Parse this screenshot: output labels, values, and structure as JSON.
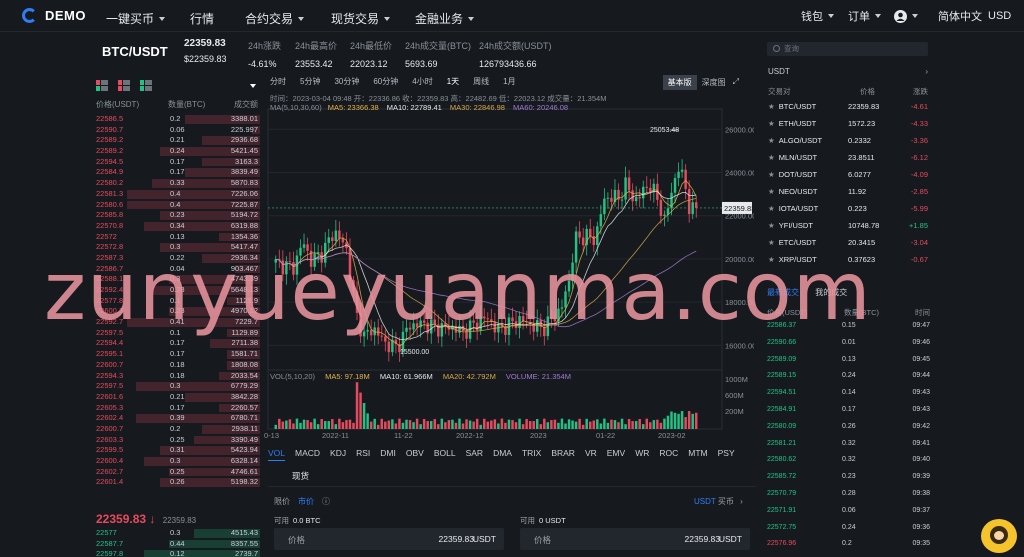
{
  "nav": {
    "brand": "DEMO",
    "items": [
      "一键买币",
      "行情",
      "合约交易",
      "现货交易",
      "金融业务"
    ],
    "wallet": "钱包",
    "orders": "订单",
    "language": "简体中文",
    "currency": "USD"
  },
  "ticker": {
    "pair": "BTC/USDT",
    "last": "22359.83",
    "last_fiat": "$22359.83",
    "change_label": "24h涨跌",
    "change": "-4.61%",
    "high_label": "24h最高价",
    "high": "23553.42",
    "low_label": "24h最低价",
    "low": "22023.12",
    "vol_label": "24h成交量(BTC)",
    "vol": "5693.69",
    "amount_label": "24h成交额(USDT)",
    "amount": "126793436.66"
  },
  "book": {
    "headers": [
      "价格(USDT)",
      "数量(BTC)",
      "成交额"
    ],
    "asks": [
      [
        "22586.5",
        "0.2",
        "3388.01"
      ],
      [
        "22590.7",
        "0.06",
        "225.997"
      ],
      [
        "22589.2",
        "0.21",
        "2936.68"
      ],
      [
        "22589.2",
        "0.24",
        "5421.45"
      ],
      [
        "22594.5",
        "0.17",
        "3163.3"
      ],
      [
        "22584.9",
        "0.17",
        "3839.49"
      ],
      [
        "22580.2",
        "0.33",
        "5870.83"
      ],
      [
        "22581.3",
        "0.4",
        "7226.06"
      ],
      [
        "22580.6",
        "0.4",
        "7225.87"
      ],
      [
        "22585.8",
        "0.23",
        "5194.72"
      ],
      [
        "22570.8",
        "0.34",
        "6319.88"
      ],
      [
        "22572",
        "0.13",
        "1354.36"
      ],
      [
        "22572.8",
        "0.3",
        "5417.47"
      ],
      [
        "22587.3",
        "0.22",
        "2936.34"
      ],
      [
        "22586.7",
        "0.04",
        "903.467"
      ],
      [
        "22588.1",
        "0.3",
        "4743.39"
      ],
      [
        "22592.4",
        "0.28",
        "5648.13"
      ],
      [
        "22577.8",
        "0.1",
        "1129.9"
      ],
      [
        "22600.3",
        "0.23",
        "4970.12"
      ],
      [
        "22592.7",
        "0.41",
        "7229.7"
      ],
      [
        "22597.5",
        "0.1",
        "1129.89"
      ],
      [
        "22594.4",
        "0.17",
        "2711.38"
      ],
      [
        "22595.1",
        "0.17",
        "1581.71"
      ],
      [
        "22600.7",
        "0.18",
        "1808.08"
      ],
      [
        "22594.3",
        "0.18",
        "2033.54"
      ],
      [
        "22597.5",
        "0.3",
        "6779.29"
      ],
      [
        "22601.6",
        "0.21",
        "3842.28"
      ],
      [
        "22605.3",
        "0.17",
        "2260.57"
      ],
      [
        "22602.4",
        "0.39",
        "6780.71"
      ],
      [
        "22600.7",
        "0.2",
        "2938.11"
      ],
      [
        "22603.3",
        "0.25",
        "3390.49"
      ],
      [
        "22599.5",
        "0.31",
        "5423.94"
      ],
      [
        "22600.4",
        "0.3",
        "6328.14"
      ],
      [
        "22602.7",
        "0.25",
        "4746.61"
      ],
      [
        "22601.4",
        "0.26",
        "5198.32"
      ]
    ],
    "ask_depth": [
      0.45,
      0.05,
      0.35,
      0.6,
      0.35,
      0.45,
      0.65,
      0.8,
      0.8,
      0.6,
      0.7,
      0.25,
      0.6,
      0.35,
      0.15,
      0.55,
      0.65,
      0.2,
      0.55,
      0.8,
      0.2,
      0.3,
      0.2,
      0.2,
      0.25,
      0.75,
      0.45,
      0.25,
      0.75,
      0.35,
      0.4,
      0.6,
      0.7,
      0.55,
      0.6
    ],
    "mid_price": "22359.83",
    "mid_arrow": "↓",
    "mid_fiat": "22359.83",
    "bids": [
      [
        "22577",
        "0.3",
        "4515.43"
      ],
      [
        "22587.7",
        "0.44",
        "8357.55"
      ],
      [
        "22597.8",
        "0.12",
        "2739.7"
      ]
    ]
  },
  "chart": {
    "intervals": [
      "分时",
      "5分钟",
      "30分钟",
      "60分钟",
      "4小时",
      "1天",
      "周线",
      "1月"
    ],
    "active_interval": "1天",
    "views": [
      "基本版",
      "深度图"
    ],
    "ohlc_line": "时间：2023-03-04 09:48   开：22336.86   收：22359.83   高：22482.69   低：22023.12   成交量：21.354M",
    "ma_label": "MA(5,10,30,60)",
    "ma5": "MA5: 23366.38",
    "ma10": "MA10: 22789.41",
    "ma30": "MA30: 22846.98",
    "ma60": "MA60: 20246.08",
    "price_axis": [
      "26000.00",
      "24000.00",
      "22000.00",
      "20000.00",
      "18000.00",
      "16000.00"
    ],
    "current_price_tag": "22359.83",
    "high_marker": "25053.48",
    "low_marker": "15500.00",
    "vol_label": "VOL(5,10,20)",
    "vol_ma5": "MA5: 97.18M",
    "vol_ma10": "MA10: 61.966M",
    "vol_ma20": "MA20: 42.792M",
    "vol_volume": "VOLUME: 21.354M",
    "vol_axis": [
      "1000M",
      "600M",
      "200M"
    ],
    "date_axis": [
      "0-13",
      "2022-11",
      "11-22",
      "2022-12",
      "2023",
      "01-22",
      "2023-02"
    ]
  },
  "indicators": [
    "VOL",
    "MACD",
    "KDJ",
    "RSI",
    "DMI",
    "OBV",
    "BOLL",
    "SAR",
    "DMA",
    "TRIX",
    "BRAR",
    "VR",
    "EMV",
    "WR",
    "ROC",
    "MTM",
    "PSY"
  ],
  "trade": {
    "tab": "现货",
    "type_limit": "限价",
    "type_market": "市价",
    "info_icon": "ⓘ",
    "quote": "USDT",
    "quote_suffix": "买币",
    "buy_avail_label": "可用",
    "buy_avail": "0.0 BTC",
    "sell_avail_label": "可用",
    "sell_avail": "0 USDT",
    "price_label": "价格",
    "price_value": "22359.83",
    "unit": "USDT"
  },
  "market": {
    "search_placeholder": "查询",
    "tab": "USDT",
    "headers": [
      "交易对",
      "价格",
      "涨跌"
    ],
    "rows": [
      [
        "BTC/USDT",
        "22359.83",
        "-4.61"
      ],
      [
        "ETH/USDT",
        "1572.23",
        "-4.33"
      ],
      [
        "ALGO/USDT",
        "0.2332",
        "-3.36"
      ],
      [
        "MLN/USDT",
        "23.8511",
        "-6.12"
      ],
      [
        "DOT/USDT",
        "6.0277",
        "-4.09"
      ],
      [
        "NEO/USDT",
        "11.92",
        "-2.85"
      ],
      [
        "IOTA/USDT",
        "0.223",
        "-5.99"
      ],
      [
        "YFI/USDT",
        "10748.78",
        "+1.85"
      ],
      [
        "ETC/USDT",
        "20.3415",
        "-3.04"
      ],
      [
        "XRP/USDT",
        "0.37623",
        "-0.67"
      ]
    ]
  },
  "trades": {
    "tab_latest": "最新成交",
    "tab_mine": "我的成交",
    "headers": [
      "价格(USDT)",
      "数量(BTC)",
      "时间"
    ],
    "rows": [
      [
        "22586.37",
        "0.15",
        "09:47",
        "up"
      ],
      [
        "22590.66",
        "0.01",
        "09:46",
        "up"
      ],
      [
        "22589.09",
        "0.13",
        "09:45",
        "up"
      ],
      [
        "22589.15",
        "0.24",
        "09:44",
        "up"
      ],
      [
        "22594.51",
        "0.14",
        "09:43",
        "up"
      ],
      [
        "22584.91",
        "0.17",
        "09:43",
        "up"
      ],
      [
        "22580.09",
        "0.26",
        "09:42",
        "up"
      ],
      [
        "22581.21",
        "0.32",
        "09:41",
        "up"
      ],
      [
        "22580.62",
        "0.32",
        "09:40",
        "up"
      ],
      [
        "22585.72",
        "0.23",
        "09:39",
        "up"
      ],
      [
        "22570.79",
        "0.28",
        "09:38",
        "up"
      ],
      [
        "22571.91",
        "0.06",
        "09:37",
        "up"
      ],
      [
        "22572.75",
        "0.24",
        "09:36",
        "up"
      ],
      [
        "22576.96",
        "0.2",
        "09:35",
        "down"
      ],
      [
        "22587.21",
        "0.13",
        "09:34",
        "up"
      ]
    ]
  },
  "watermark": "zunyueyuanma.com",
  "colors": {
    "up": "#24c185",
    "down": "#e64a5e",
    "accent": "#2f7cf6",
    "bg": "#161a1e"
  }
}
